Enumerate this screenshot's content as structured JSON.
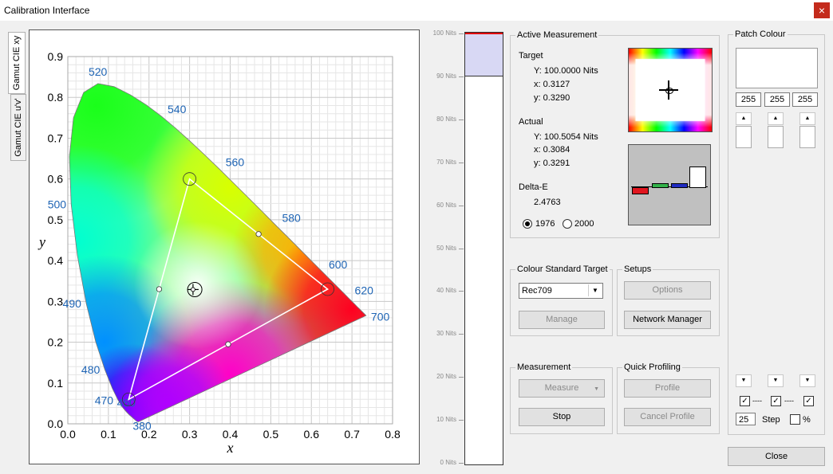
{
  "window": {
    "title": "Calibration Interface",
    "close_glyph": "×"
  },
  "tabs": [
    {
      "label": "Gamut CIE xy"
    },
    {
      "label": "Gamut CIE u'v'"
    }
  ],
  "chart_data": {
    "type": "scatter",
    "xlabel": "x",
    "ylabel": "y",
    "xlim": [
      0.0,
      0.8
    ],
    "ylim": [
      0.0,
      0.9
    ],
    "grid": true,
    "x_ticks": [
      "0.0",
      "0.1",
      "0.2",
      "0.3",
      "0.4",
      "0.5",
      "0.6",
      "0.7",
      "0.8"
    ],
    "y_ticks": [
      "0.0",
      "0.1",
      "0.2",
      "0.3",
      "0.4",
      "0.5",
      "0.6",
      "0.7",
      "0.8",
      "0.9"
    ],
    "wavelength_labels": [
      {
        "text": "520",
        "x": 0.074,
        "y": 0.834
      },
      {
        "text": "540",
        "x": 0.23,
        "y": 0.754
      },
      {
        "text": "560",
        "x": 0.373,
        "y": 0.624
      },
      {
        "text": "580",
        "x": 0.512,
        "y": 0.487
      },
      {
        "text": "600",
        "x": 0.627,
        "y": 0.373
      },
      {
        "text": "620",
        "x": 0.691,
        "y": 0.309
      },
      {
        "text": "700",
        "x": 0.735,
        "y": 0.265
      },
      {
        "text": "500",
        "x": 0.008,
        "y": 0.538
      },
      {
        "text": "490",
        "x": 0.045,
        "y": 0.295
      },
      {
        "text": "480",
        "x": 0.091,
        "y": 0.133
      },
      {
        "text": "470",
        "x": 0.124,
        "y": 0.058
      },
      {
        "text": "460",
        "x": 0.144,
        "y": 0.03
      },
      {
        "text": "380",
        "x": 0.175,
        "y": 0.005
      }
    ],
    "gamut_triangle": [
      [
        0.64,
        0.33
      ],
      [
        0.3,
        0.6
      ],
      [
        0.15,
        0.06
      ]
    ],
    "midpoints": [
      [
        0.47,
        0.465
      ],
      [
        0.225,
        0.33
      ],
      [
        0.395,
        0.195
      ]
    ],
    "target_point": {
      "x": 0.3127,
      "y": 0.329
    },
    "actual_point": {
      "x": 0.3084,
      "y": 0.3291
    }
  },
  "luminance": {
    "ticks": [
      "100 Nits",
      "90 Nits",
      "80 Nits",
      "70 Nits",
      "60 Nits",
      "50 Nits",
      "40 Nits",
      "30 Nits",
      "20 Nits",
      "10 Nits",
      "0 Nits"
    ],
    "target": 100.0,
    "actual": 100.5054
  },
  "active_measurement": {
    "title": "Active Measurement",
    "target_label": "Target",
    "target_Y": "Y: 100.0000 Nits",
    "target_x": "x: 0.3127",
    "target_y": "y: 0.3290",
    "actual_label": "Actual",
    "actual_Y": "Y: 100.5054 Nits",
    "actual_x": "x: 0.3084",
    "actual_y": "y: 0.3291",
    "delta_label": "Delta-E",
    "delta_value": "2.4763",
    "radio_1976": "1976",
    "radio_2000": "2000",
    "selected": "1976",
    "rgb_bars": {
      "colors": [
        "#e0161f",
        "#33b24a",
        "#1f2bc2",
        "#ffffff"
      ]
    }
  },
  "colour_standard": {
    "title": "Colour Standard Target",
    "selected": "Rec709",
    "manage_label": "Manage"
  },
  "setups": {
    "title": "Setups",
    "options_label": "Options",
    "network_label": "Network Manager"
  },
  "measurement": {
    "title": "Measurement",
    "measure_label": "Measure",
    "stop_label": "Stop"
  },
  "quick_profiling": {
    "title": "Quick Profiling",
    "profile_label": "Profile",
    "cancel_label": "Cancel Profile"
  },
  "patch": {
    "title": "Patch Colour",
    "r": "255",
    "g": "255",
    "b": "255",
    "sep1": "----",
    "sep2": "----",
    "step_value": "25",
    "step_label": "Step",
    "percent_label": "%"
  },
  "close_label": "Close"
}
